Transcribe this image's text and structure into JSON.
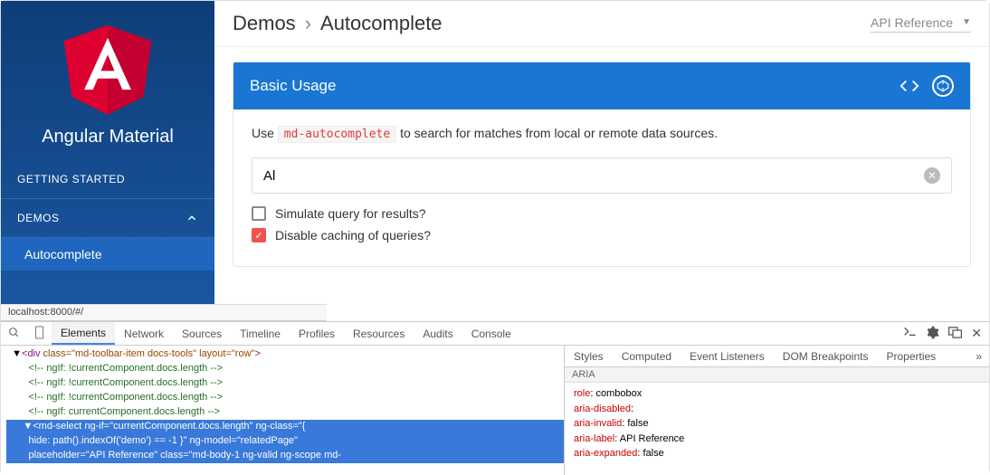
{
  "sidebar": {
    "brand": "Angular Material",
    "items": [
      {
        "label": "GETTING STARTED"
      },
      {
        "label": "DEMOS"
      }
    ],
    "subitem": "Autocomplete"
  },
  "breadcrumbs": {
    "root": "Demos",
    "sep": "›",
    "current": "Autocomplete"
  },
  "api_select": {
    "label": "API Reference",
    "caret": "▼"
  },
  "card": {
    "title": "Basic Usage",
    "desc_pre": "Use ",
    "code": "md-autocomplete",
    "desc_post": " to search for matches from local or remote data sources.",
    "input_value": "Al",
    "opt1": "Simulate query for results?",
    "opt2": "Disable caching of queries?"
  },
  "urlbar": "localhost:8000/#/",
  "devtools": {
    "tabs": [
      "Elements",
      "Network",
      "Sources",
      "Timeline",
      "Profiles",
      "Resources",
      "Audits",
      "Console"
    ],
    "dom": {
      "l1_tag": "div",
      "l1_attrs": " class=\"md-toolbar-item docs-tools\" layout=\"row\"",
      "c1": "<!-- ngIf: !currentComponent.docs.length -->",
      "c2": "<!-- ngIf: !currentComponent.docs.length -->",
      "c3": "<!-- ngIf: !currentComponent.docs.length -->",
      "c4": "<!-- ngIf: currentComponent.docs.length -->",
      "sel1": "<md-select ng-if=\"currentComponent.docs.length\" ng-class=\"{",
      "sel2": "hide: path().indexOf('demo') == -1 }\" ng-model=\"relatedPage\"",
      "sel3": "placeholder=\"API Reference\" class=\"md-body-1 ng-valid ng-scope md-"
    },
    "side_tabs": [
      "Styles",
      "Computed",
      "Event Listeners",
      "DOM Breakpoints",
      "Properties"
    ],
    "aria_header": "ARIA",
    "aria": [
      {
        "k": "role",
        "v": "combobox"
      },
      {
        "k": "aria-disabled",
        "v": ""
      },
      {
        "k": "aria-invalid",
        "v": "false"
      },
      {
        "k": "aria-label",
        "v": "API Reference"
      },
      {
        "k": "aria-expanded",
        "v": "false"
      }
    ]
  }
}
